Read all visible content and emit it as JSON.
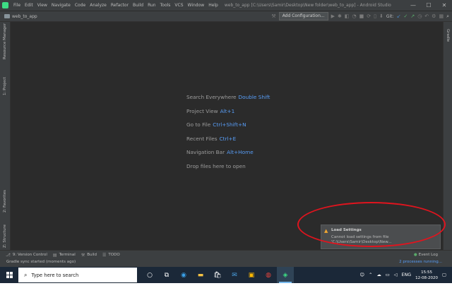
{
  "title_bar": {
    "menu": [
      "File",
      "Edit",
      "View",
      "Navigate",
      "Code",
      "Analyze",
      "Refactor",
      "Build",
      "Run",
      "Tools",
      "VCS",
      "Window",
      "Help"
    ],
    "window_title": "web_to_app [C:\\Users\\Samir\\Desktop\\New folder\\web_to_app] - Android Studio",
    "controls": [
      "—",
      "☐",
      "✕"
    ]
  },
  "toolbar": {
    "project": "web_to_app",
    "add_configuration": "Add Configuration...",
    "git_label": "Git:"
  },
  "side_panels": {
    "left_top": [
      "Resource Manager",
      "1: Project"
    ],
    "left_bottom": [
      "2: Favorites",
      "Z: Structure"
    ],
    "right": [
      "Gradle"
    ]
  },
  "editor_hints": [
    {
      "label": "Search Everywhere",
      "shortcut": "Double Shift"
    },
    {
      "label": "Project View",
      "shortcut": "Alt+1"
    },
    {
      "label": "Go to File",
      "shortcut": "Ctrl+Shift+N"
    },
    {
      "label": "Recent Files",
      "shortcut": "Ctrl+E"
    },
    {
      "label": "Navigation Bar",
      "shortcut": "Alt+Home"
    },
    {
      "label": "Drop files here to open",
      "shortcut": ""
    }
  ],
  "notification": {
    "title": "Load Settings",
    "body": "Cannot load settings from file",
    "path": "'C:\\Users\\Samir\\Desktop\\New..."
  },
  "bottom_tools": [
    "9: Version Control",
    "Terminal",
    "Build",
    "TODO"
  ],
  "event_log": "Event Log",
  "status": {
    "left": "Gradle sync started (moments ago)",
    "right": "2 processes running..."
  },
  "taskbar": {
    "search_placeholder": "Type here to search",
    "language": "ENG",
    "time": "15:55",
    "date": "12-08-2020"
  }
}
